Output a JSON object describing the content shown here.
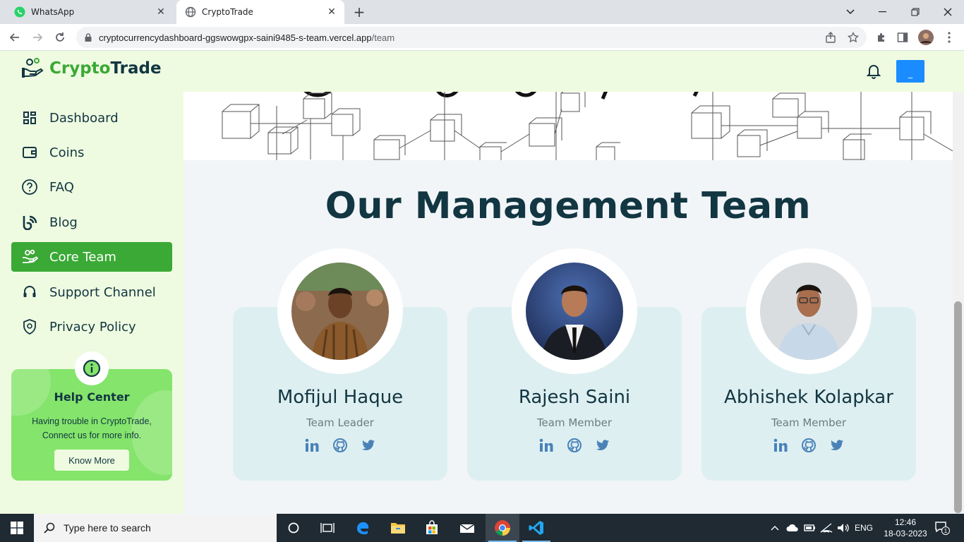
{
  "browser": {
    "tabs": [
      {
        "title": "WhatsApp",
        "icon": "whatsapp-icon",
        "active": false
      },
      {
        "title": "CryptoTrade",
        "icon": "globe-icon",
        "active": true
      }
    ],
    "url_host": "cryptocurrencydashboard-ggswowgpx-saini9485-s-team.vercel.app",
    "url_path": "/team"
  },
  "app": {
    "brand": {
      "part1": "Crypto",
      "part2": "Trade"
    },
    "profile_button_label": "_",
    "sidebar": {
      "items": [
        {
          "label": "Dashboard",
          "icon": "dashboard-icon",
          "active": false
        },
        {
          "label": "Coins",
          "icon": "wallet-icon",
          "active": false
        },
        {
          "label": "FAQ",
          "icon": "question-icon",
          "active": false
        },
        {
          "label": "Blog",
          "icon": "blog-icon",
          "active": false
        },
        {
          "label": "Core Team",
          "icon": "team-icon",
          "active": true
        },
        {
          "label": "Support Channel",
          "icon": "headset-icon",
          "active": false
        },
        {
          "label": "Privacy Policy",
          "icon": "shield-icon",
          "active": false
        }
      ]
    },
    "help_center": {
      "title": "Help Center",
      "line1": "Having trouble in CryptoTrade,",
      "line2": "Connect us for more info.",
      "button": "Know More"
    },
    "main": {
      "section_title": "Our Management Team",
      "members": [
        {
          "name": "Mofijul Haque",
          "role": "Team Leader"
        },
        {
          "name": "Rajesh Saini",
          "role": "Team Member"
        },
        {
          "name": "Abhishek Kolapkar",
          "role": "Team Member"
        }
      ]
    }
  },
  "taskbar": {
    "search_placeholder": "Type here to search",
    "language": "ENG",
    "time": "12:46",
    "date": "18-03-2023",
    "notification_count": "1"
  },
  "colors": {
    "brand_green": "#3aa935",
    "dark_navy": "#123642",
    "sidebar_bg": "#eefbe0",
    "help_card": "#84e46b",
    "card_bg": "#deeff1",
    "profile_blue": "#1a8cff"
  }
}
